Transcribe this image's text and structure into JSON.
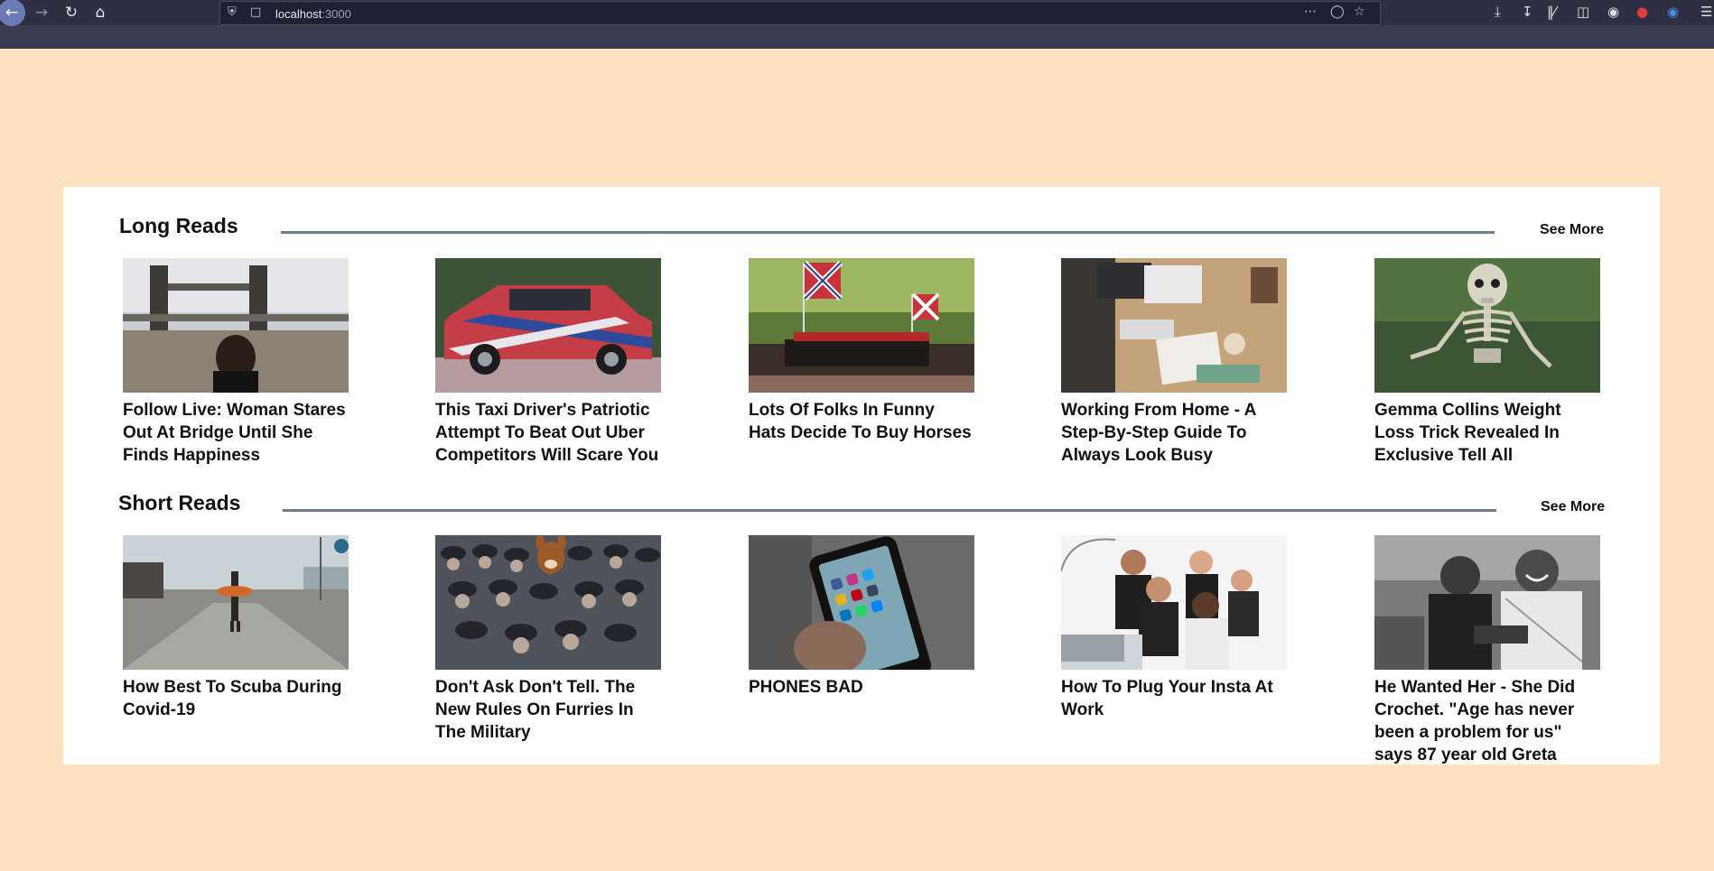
{
  "browser": {
    "url_host": "localhost",
    "url_port": ":3000",
    "icons": [
      "back-icon",
      "forward-icon",
      "reload-icon",
      "home-icon",
      "shield-icon",
      "page-icon",
      "more-icon",
      "pocket-icon",
      "star-icon",
      "downloads-icon",
      "library-icon",
      "sidebar-icon",
      "account-icon",
      "menu-icon"
    ]
  },
  "sections": [
    {
      "title": "Long Reads",
      "see_more": "See More",
      "articles": [
        {
          "headline": "Follow Live: Woman Stares Out At Bridge Until She Finds Happiness",
          "image": "bridge-photo"
        },
        {
          "headline": "This Taxi Driver's Patriotic Attempt To Beat Out Uber Competitors Will Scare You",
          "image": "taxi-photo"
        },
        {
          "headline": "Lots Of Folks In Funny Hats Decide To Buy Horses",
          "image": "horses-parade-photo"
        },
        {
          "headline": "Working From Home - A Step-By-Step Guide To Always Look Busy",
          "image": "desk-photo"
        },
        {
          "headline": "Gemma Collins Weight Loss Trick Revealed In Exclusive Tell All",
          "image": "skeleton-photo"
        }
      ]
    },
    {
      "title": "Short Reads",
      "see_more": "See More",
      "articles": [
        {
          "headline": "How Best To Scuba During Covid-19",
          "image": "street-photo"
        },
        {
          "headline": "Don't Ask Don't Tell. The New Rules On Furries In The Military",
          "image": "military-photo"
        },
        {
          "headline": "PHONES BAD",
          "image": "phone-photo"
        },
        {
          "headline": "How To Plug Your Insta At Work",
          "image": "office-team-photo"
        },
        {
          "headline": "He Wanted Her - She Did Crochet. \"Age has never been a problem for us\" says 87 year old Greta",
          "image": "friends-photo"
        }
      ]
    }
  ],
  "colors": {
    "page_background": "#fde2c2",
    "card_background": "#ffffff",
    "rule": "#6d7c8e",
    "browser_chrome": "#3b3c50"
  }
}
